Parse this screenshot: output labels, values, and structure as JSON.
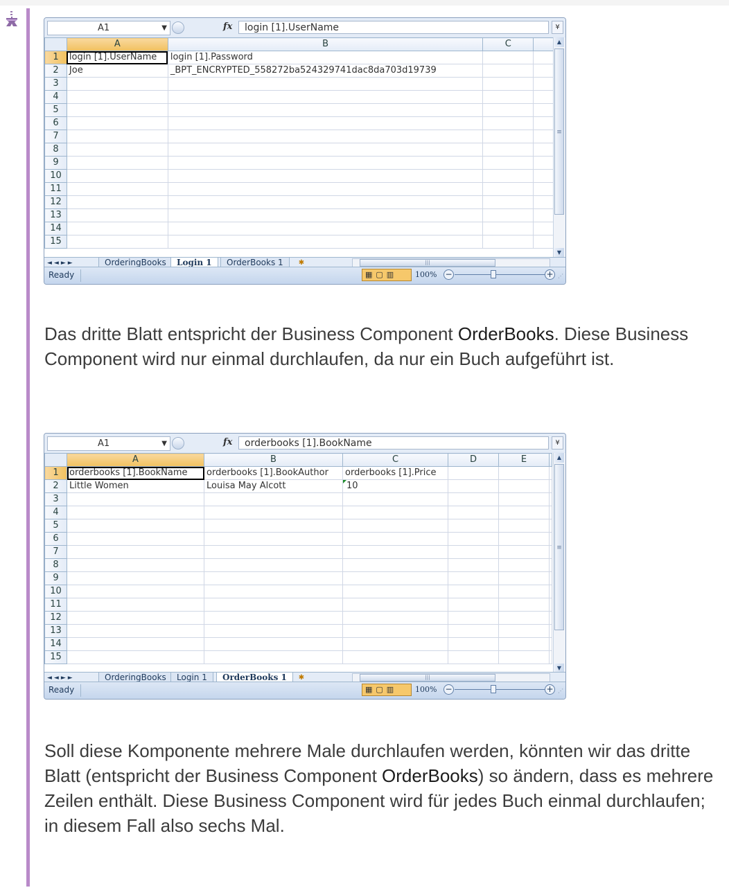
{
  "sheet1": {
    "name_box": "A1",
    "formula": "login [1].UserName",
    "columns": [
      "A",
      "B",
      "C"
    ],
    "rows": [
      [
        "login [1].UserName",
        "login [1].Password",
        ""
      ],
      [
        "Joe",
        "_BPT_ENCRYPTED_558272ba524329741dac8da703d19739",
        ""
      ],
      [
        "",
        "",
        ""
      ],
      [
        "",
        "",
        ""
      ],
      [
        "",
        "",
        ""
      ],
      [
        "",
        "",
        ""
      ],
      [
        "",
        "",
        ""
      ],
      [
        "",
        "",
        ""
      ],
      [
        "",
        "",
        ""
      ],
      [
        "",
        "",
        ""
      ],
      [
        "",
        "",
        ""
      ],
      [
        "",
        "",
        ""
      ],
      [
        "",
        "",
        ""
      ],
      [
        "",
        "",
        ""
      ],
      [
        "",
        "",
        ""
      ]
    ],
    "tabs": [
      "OrderingBooks",
      "Login 1",
      "OrderBooks 1"
    ],
    "active_tab": "Login 1",
    "status": "Ready",
    "zoom": "100%"
  },
  "paragraph1": {
    "before": "Das dritte Blatt entspricht der Business Component ",
    "bold": "OrderBooks",
    "after": ". Diese Business Component wird nur einmal durchlaufen, da nur ein Buch aufgeführt ist."
  },
  "sheet2": {
    "name_box": "A1",
    "formula": "orderbooks [1].BookName",
    "columns": [
      "A",
      "B",
      "C",
      "D",
      "E"
    ],
    "rows": [
      [
        "orderbooks [1].BookName",
        "orderbooks [1].BookAuthor",
        "orderbooks [1].Price",
        "",
        ""
      ],
      [
        "Little Women",
        "Louisa May Alcott",
        "10",
        "",
        ""
      ],
      [
        "",
        "",
        "",
        "",
        ""
      ],
      [
        "",
        "",
        "",
        "",
        ""
      ],
      [
        "",
        "",
        "",
        "",
        ""
      ],
      [
        "",
        "",
        "",
        "",
        ""
      ],
      [
        "",
        "",
        "",
        "",
        ""
      ],
      [
        "",
        "",
        "",
        "",
        ""
      ],
      [
        "",
        "",
        "",
        "",
        ""
      ],
      [
        "",
        "",
        "",
        "",
        ""
      ],
      [
        "",
        "",
        "",
        "",
        ""
      ],
      [
        "",
        "",
        "",
        "",
        ""
      ],
      [
        "",
        "",
        "",
        "",
        ""
      ],
      [
        "",
        "",
        "",
        "",
        ""
      ],
      [
        "",
        "",
        "",
        "",
        ""
      ]
    ],
    "tabs": [
      "OrderingBooks",
      "Login 1",
      "OrderBooks 1"
    ],
    "active_tab": "OrderBooks 1",
    "status": "Ready",
    "zoom": "100%"
  },
  "paragraph2": {
    "before": "Soll diese Komponente mehrere Male durchlaufen werden, könnten wir das dritte Blatt (entspricht der Business Component ",
    "bold": "OrderBooks",
    "after": ") so ändern, dass es mehrere Zeilen enthält. Diese Business Component wird für jedes Buch einmal durchlaufen; in diesem Fall also sechs Mal."
  },
  "colors": {
    "accent_bar": "#b98ac9",
    "selected_header": "#f1c15f"
  },
  "icons": {
    "note": "example-note-icon"
  }
}
